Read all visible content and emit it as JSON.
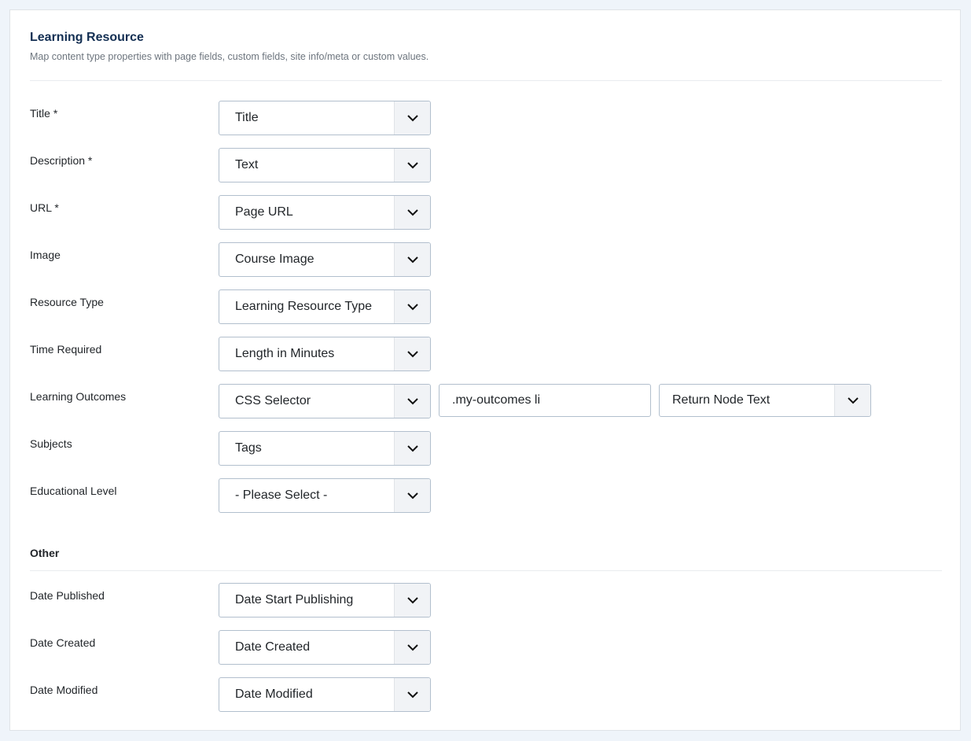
{
  "panel": {
    "title": "Learning Resource",
    "subtitle": "Map content type properties with page fields, custom fields, site info/meta or custom values."
  },
  "fields": [
    {
      "label": "Title *",
      "value": "Title"
    },
    {
      "label": "Description *",
      "value": "Text"
    },
    {
      "label": "URL *",
      "value": "Page URL"
    },
    {
      "label": "Image",
      "value": "Course Image"
    },
    {
      "label": "Resource Type",
      "value": "Learning Resource Type"
    },
    {
      "label": "Time Required",
      "value": "Length in Minutes"
    },
    {
      "label": "Learning Outcomes",
      "value": "CSS Selector",
      "selector_value": ".my-outcomes li",
      "mode_value": "Return Node Text"
    },
    {
      "label": "Subjects",
      "value": "Tags"
    },
    {
      "label": "Educational Level",
      "value": "- Please Select -"
    }
  ],
  "other": {
    "heading": "Other",
    "fields": [
      {
        "label": "Date Published",
        "value": "Date Start Publishing"
      },
      {
        "label": "Date Created",
        "value": "Date Created"
      },
      {
        "label": "Date Modified",
        "value": "Date Modified"
      }
    ]
  },
  "icons": {
    "dropdown": "chevron-down-icon"
  }
}
